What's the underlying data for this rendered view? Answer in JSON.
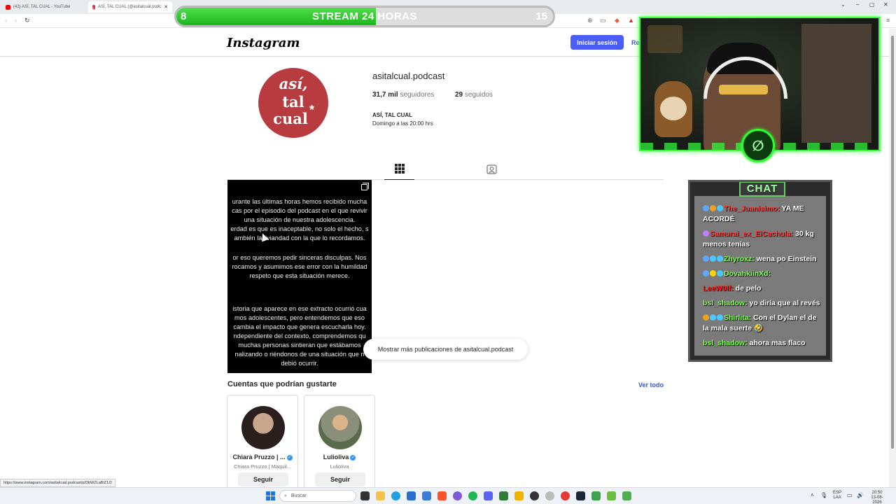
{
  "browser": {
    "tabs": [
      {
        "label": "(43) ASÍ, TAL CUAL - YouTube",
        "active": false
      },
      {
        "label": "ASÍ, TAL CUAL (@asitalcual.podc",
        "active": true
      }
    ]
  },
  "stream_bar": {
    "left_value": "8",
    "title": "STREAM 24 HORAS",
    "right_value": "15",
    "fill_fraction": 0.53
  },
  "instagram": {
    "logo": "Instagram",
    "login_label": "Iniciar sesión",
    "register_label": "Re",
    "profile": {
      "avatar_lines": [
        "así,",
        "tal",
        "cual"
      ],
      "avatar_star": "*",
      "username": "asitalcual.podcast",
      "followers_count": "31,7 mil",
      "followers_label": "seguidores",
      "following_count": "29",
      "following_label": "seguidos",
      "full_name": "ASÍ, TAL CUAL",
      "bio": "Domingo a las 20:00 hrs"
    },
    "post": {
      "paragraphs": [
        [
          "urante las últimas horas hemos recibido mucha",
          "cas por el episodio del podcast en el que revivir",
          "una situación de nuestra adolescencia.",
          "erdad es que es inaceptable, no solo el hecho, s",
          "ambién la liviandad con la que lo recordamos."
        ],
        [
          "or eso queremos pedir sinceras disculpas. Nos",
          "rocamos y asumimos ese error con la humildad",
          "respeto que esta situación merece."
        ],
        [
          "istoria que aparece en ese extracto ocurrió cua",
          "mos adolescentes, pero entendemos que eso",
          "cambia el impacto que genera escucharla hoy.",
          "ndependiente del contexto, comprendemos qu",
          "muchas personas sintieran que estábamos",
          "nalizando o riéndonos de una situación que n",
          "debió ocurrir."
        ]
      ]
    },
    "show_more": "Mostrar más publicaciones de asitalcual.podcast",
    "suggestions_title": "Cuentas que podrían gustarte",
    "see_all": "Ver todo",
    "suggestions": [
      {
        "name": "Chiara Pruzzo | ...",
        "subtitle": "Chiara Pruzzo | Maquil...",
        "button": "Seguir"
      },
      {
        "name": "Lulioliva",
        "subtitle": "Lulioliva",
        "button": "Seguir"
      }
    ],
    "status_url": "https://www.instagram.com/asitalcual.podcast/p/DbWZLaBiZ1Z/"
  },
  "chat": {
    "title": "CHAT",
    "messages": [
      {
        "user": "The_Juanisimo:",
        "text": " YA ME ACORDÉ",
        "color": "#ff4040"
      },
      {
        "user": "Samurai_ex_ElCachula:",
        "text": " 30 kg menos tenías",
        "color": "#ff4040"
      },
      {
        "user": "Zhyroxz:",
        "text": " wena po Einstein",
        "color": "#7cff4a"
      },
      {
        "user": "DovahkiinXd:",
        "text": " ",
        "color": "#7cff4a"
      },
      {
        "user": "LeeW0lf:",
        "text": " de pelo",
        "color": "#ff2020"
      },
      {
        "user": "bsl_shadow:",
        "text": " yo diría que al revés",
        "color": "#7cff4a"
      },
      {
        "user": "Shirlita:",
        "text": " Con el Dylan el de la mala suerte 🤣",
        "color": "#7cff4a"
      },
      {
        "user": "bsl_shadow:",
        "text": " ahora mas flaco",
        "color": "#7cff4a"
      }
    ]
  },
  "taskbar": {
    "search_placeholder": "Buscar",
    "lang_top": "ESP",
    "lang_bottom": "LAA",
    "time": "20:50",
    "date": "13-08-2026"
  }
}
